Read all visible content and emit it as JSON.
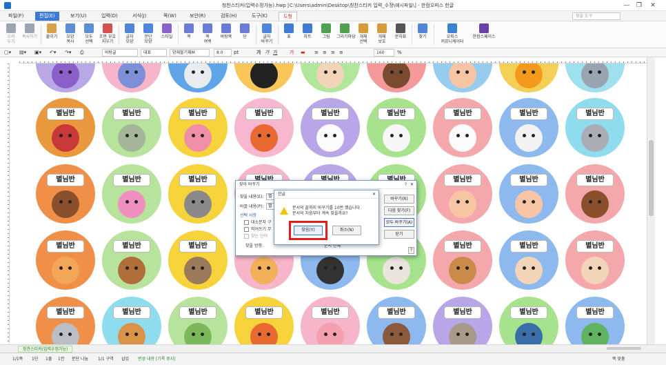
{
  "window": {
    "title": "청찬스티커(입력수정가능).hwp [C:\\Users\\admin\\Desktop\\칭찬스티커 입력_수정\\예시파일\\] - 한컴오피스 한글",
    "minimize": "—",
    "maximize": "❐",
    "close": "✕"
  },
  "menubar": {
    "items": [
      "파일(F)",
      "편집(E)",
      "보기(U)",
      "입력(D)",
      "서식(J)",
      "쪽(W)",
      "보안(R)",
      "검토(H)",
      "도구(K)",
      "도형"
    ],
    "active_index": 1,
    "tab_index": 9,
    "search_placeholder": "찾을 도구"
  },
  "ribbon": {
    "buttons": [
      {
        "label": "오려\n두기",
        "color": "#9aa6b2",
        "dim": true
      },
      {
        "label": "복사하기",
        "color": "#9aa6b2",
        "dim": true
      },
      {
        "label": "붙이기",
        "color": "#d8a24a"
      },
      {
        "label": "모양\n복사",
        "color": "#5a8fd6"
      },
      {
        "label": "모두\n선택",
        "color": "#5a8fd6"
      },
      {
        "label": "조판 부호\n지우기",
        "color": "#d65050"
      },
      {
        "label": "글자\n모양",
        "color": "#4f86d9"
      },
      {
        "label": "문단\n모양",
        "color": "#4f86d9"
      },
      {
        "label": "스타일",
        "color": "#8a62c9"
      },
      {
        "label": "쪽",
        "color": "#6b7bd6"
      },
      {
        "label": "쪽\n여백",
        "color": "#6b7bd6"
      },
      {
        "label": "바탕쪽",
        "color": "#6b7bd6"
      },
      {
        "label": "단",
        "color": "#6b7bd6"
      },
      {
        "label": "글자\n바꾸기",
        "color": "#4f86d9"
      },
      {
        "label": "표",
        "color": "#3f7ad0"
      },
      {
        "label": "차트",
        "color": "#3f7ad0"
      },
      {
        "label": "그림",
        "color": "#4fa14f"
      },
      {
        "label": "그리기마당",
        "color": "#4fa14f"
      },
      {
        "label": "개체\n선택",
        "color": "#d69b3a"
      },
      {
        "label": "개체\n보호",
        "color": "#d69b3a"
      },
      {
        "label": "문자표",
        "color": "#555"
      },
      {
        "label": "찾기",
        "color": "#4f86d9"
      },
      {
        "label": "오피스\n커뮤니케이터",
        "color": "#3a82d0"
      },
      {
        "label": "한컴스페이스",
        "color": "#6b3fa8"
      }
    ]
  },
  "formatbar": {
    "style": "바탕글",
    "lang": "대표",
    "font": "양재블기체M",
    "size": "8.0",
    "unit": "pt",
    "zoom": "160",
    "zoom_unit": "%"
  },
  "document": {
    "sticker_label": "별님반",
    "stickers": [
      {
        "bg": "#b8a9e6",
        "face": "#8b5fc9"
      },
      {
        "bg": "#f6b5c8",
        "face": "#7d8fd8"
      },
      {
        "bg": "#5fa5e8",
        "face": "#e9ecef"
      },
      {
        "bg": "#f9c65a",
        "face": "#222"
      },
      {
        "bg": "#b1e79a",
        "face": "#f2d5b9"
      },
      {
        "bg": "#f49a9a",
        "face": "#7a4b2e"
      },
      {
        "bg": "#96cdef",
        "face": "#f7c5a4"
      },
      {
        "bg": "#f4cf55",
        "face": "#f39a1e"
      },
      {
        "bg": "#9fe0ee",
        "face": "#9aa3b0"
      },
      {
        "bg": "#e9983d",
        "face": "#c93838"
      },
      {
        "bg": "#b7e39c",
        "face": "#a5b59a"
      },
      {
        "bg": "#f7d33b",
        "face": "#ef8fa5"
      },
      {
        "bg": "#f7b7cf",
        "face": "#e86a32"
      },
      {
        "bg": "#b9a6e9",
        "face": "#fbfbfb"
      },
      {
        "bg": "#a6e38c",
        "face": "#f7f7f7"
      },
      {
        "bg": "#f4a8ab",
        "face": "#fbfbfb"
      },
      {
        "bg": "#8db9ef",
        "face": "#f2f2f2"
      },
      {
        "bg": "#8fdcef",
        "face": "#a9aeb6"
      },
      {
        "bg": "#f08f48",
        "face": "#8a4f2d"
      },
      {
        "bg": "#b7e39c",
        "face": "#ef8fc0"
      },
      {
        "bg": "#f7d33b",
        "face": "#8a8a8a"
      },
      {
        "bg": "#f6b5c8",
        "face": "#e9a53d"
      },
      {
        "bg": "#b9a6e9",
        "face": "#fbfbfb"
      },
      {
        "bg": "#a6e38c",
        "face": "#f7c5a4"
      },
      {
        "bg": "#f4a8ab",
        "face": "#f7c5a4"
      },
      {
        "bg": "#8db9ef",
        "face": "#f7c5a4"
      },
      {
        "bg": "#f4a8ab",
        "face": "#8a4f2d"
      },
      {
        "bg": "#f08f48",
        "face": "#f3a65a"
      },
      {
        "bg": "#b7e39c",
        "face": "#b06f3a"
      },
      {
        "bg": "#f7d33b",
        "face": "#9a7a5a"
      },
      {
        "bg": "#f6b5c8",
        "face": "#f3b05a"
      },
      {
        "bg": "#8db9ef",
        "face": "#333"
      },
      {
        "bg": "#a6e38c",
        "face": "#e9e5dc"
      },
      {
        "bg": "#f4a8ab",
        "face": "#c98a4a"
      },
      {
        "bg": "#8db9ef",
        "face": "#f2d5b9"
      },
      {
        "bg": "#f4a8ab",
        "face": "#f2d5b9"
      },
      {
        "bg": "#f08f48",
        "face": "#b9bec6"
      },
      {
        "bg": "#8fdcef",
        "face": "#d99248"
      },
      {
        "bg": "#b7e39c",
        "face": "#7bb85a"
      },
      {
        "bg": "#f7d33b",
        "face": "#e86a32"
      },
      {
        "bg": "#f6b5c8",
        "face": "#f5a0b0"
      },
      {
        "bg": "#8db9ef",
        "face": "#8a5a3a"
      },
      {
        "bg": "#b9a6e9",
        "face": "#a89a8a"
      },
      {
        "bg": "#a6e38c",
        "face": "#3a6ea8"
      },
      {
        "bg": "#8db9ef",
        "face": "#5fb35f"
      },
      {
        "bg": "#f4a8ab",
        "face": "#e86a32"
      },
      {
        "bg": "#f08f48",
        "face": "#e25a3a"
      },
      {
        "bg": "#8fdcef",
        "face": "#f2d5b9"
      }
    ]
  },
  "find_replace_dialog": {
    "title": "찾아 바꾸기",
    "find_label": "찾을 내용(E):",
    "find_value": "별",
    "replace_label": "바꿀 내용(P):",
    "replace_value": "별",
    "options_title": "선택 사항",
    "opt_case": "대소문자 구",
    "opt_space": "띄어쓰기 무",
    "opt_unit": "찾는 단어",
    "direction_label": "찾을 방향:",
    "direction_value": "문서 전체",
    "btn_replace": "바꾸기(R)",
    "btn_next": "다음 찾기(F)",
    "btn_replace_all": "모두 바꾸기(A)",
    "btn_close": "닫기",
    "help": "?"
  },
  "confirm_dialog": {
    "title": "한글",
    "message_line1": "문서의 끝까지 바꾸기를 10번 했습니다.",
    "message_line2": "문서의 처음부터 계속 찾을까요?",
    "btn_yes": "찾음(Y)",
    "btn_cancel": "취소(N)",
    "close": "✕"
  },
  "tabs": {
    "doc_tab": "칭찬스티커(입력수정가능)"
  },
  "statusbar": {
    "page": "1/1쪽",
    "section": "1단",
    "line": "1줄",
    "col": "1칸",
    "split": "문단 나눔",
    "area": "1/1 구역",
    "insert": "삽입",
    "tracking": "변경 내용 [기록 중지]",
    "zoom_label": "쪽 맞춤"
  }
}
